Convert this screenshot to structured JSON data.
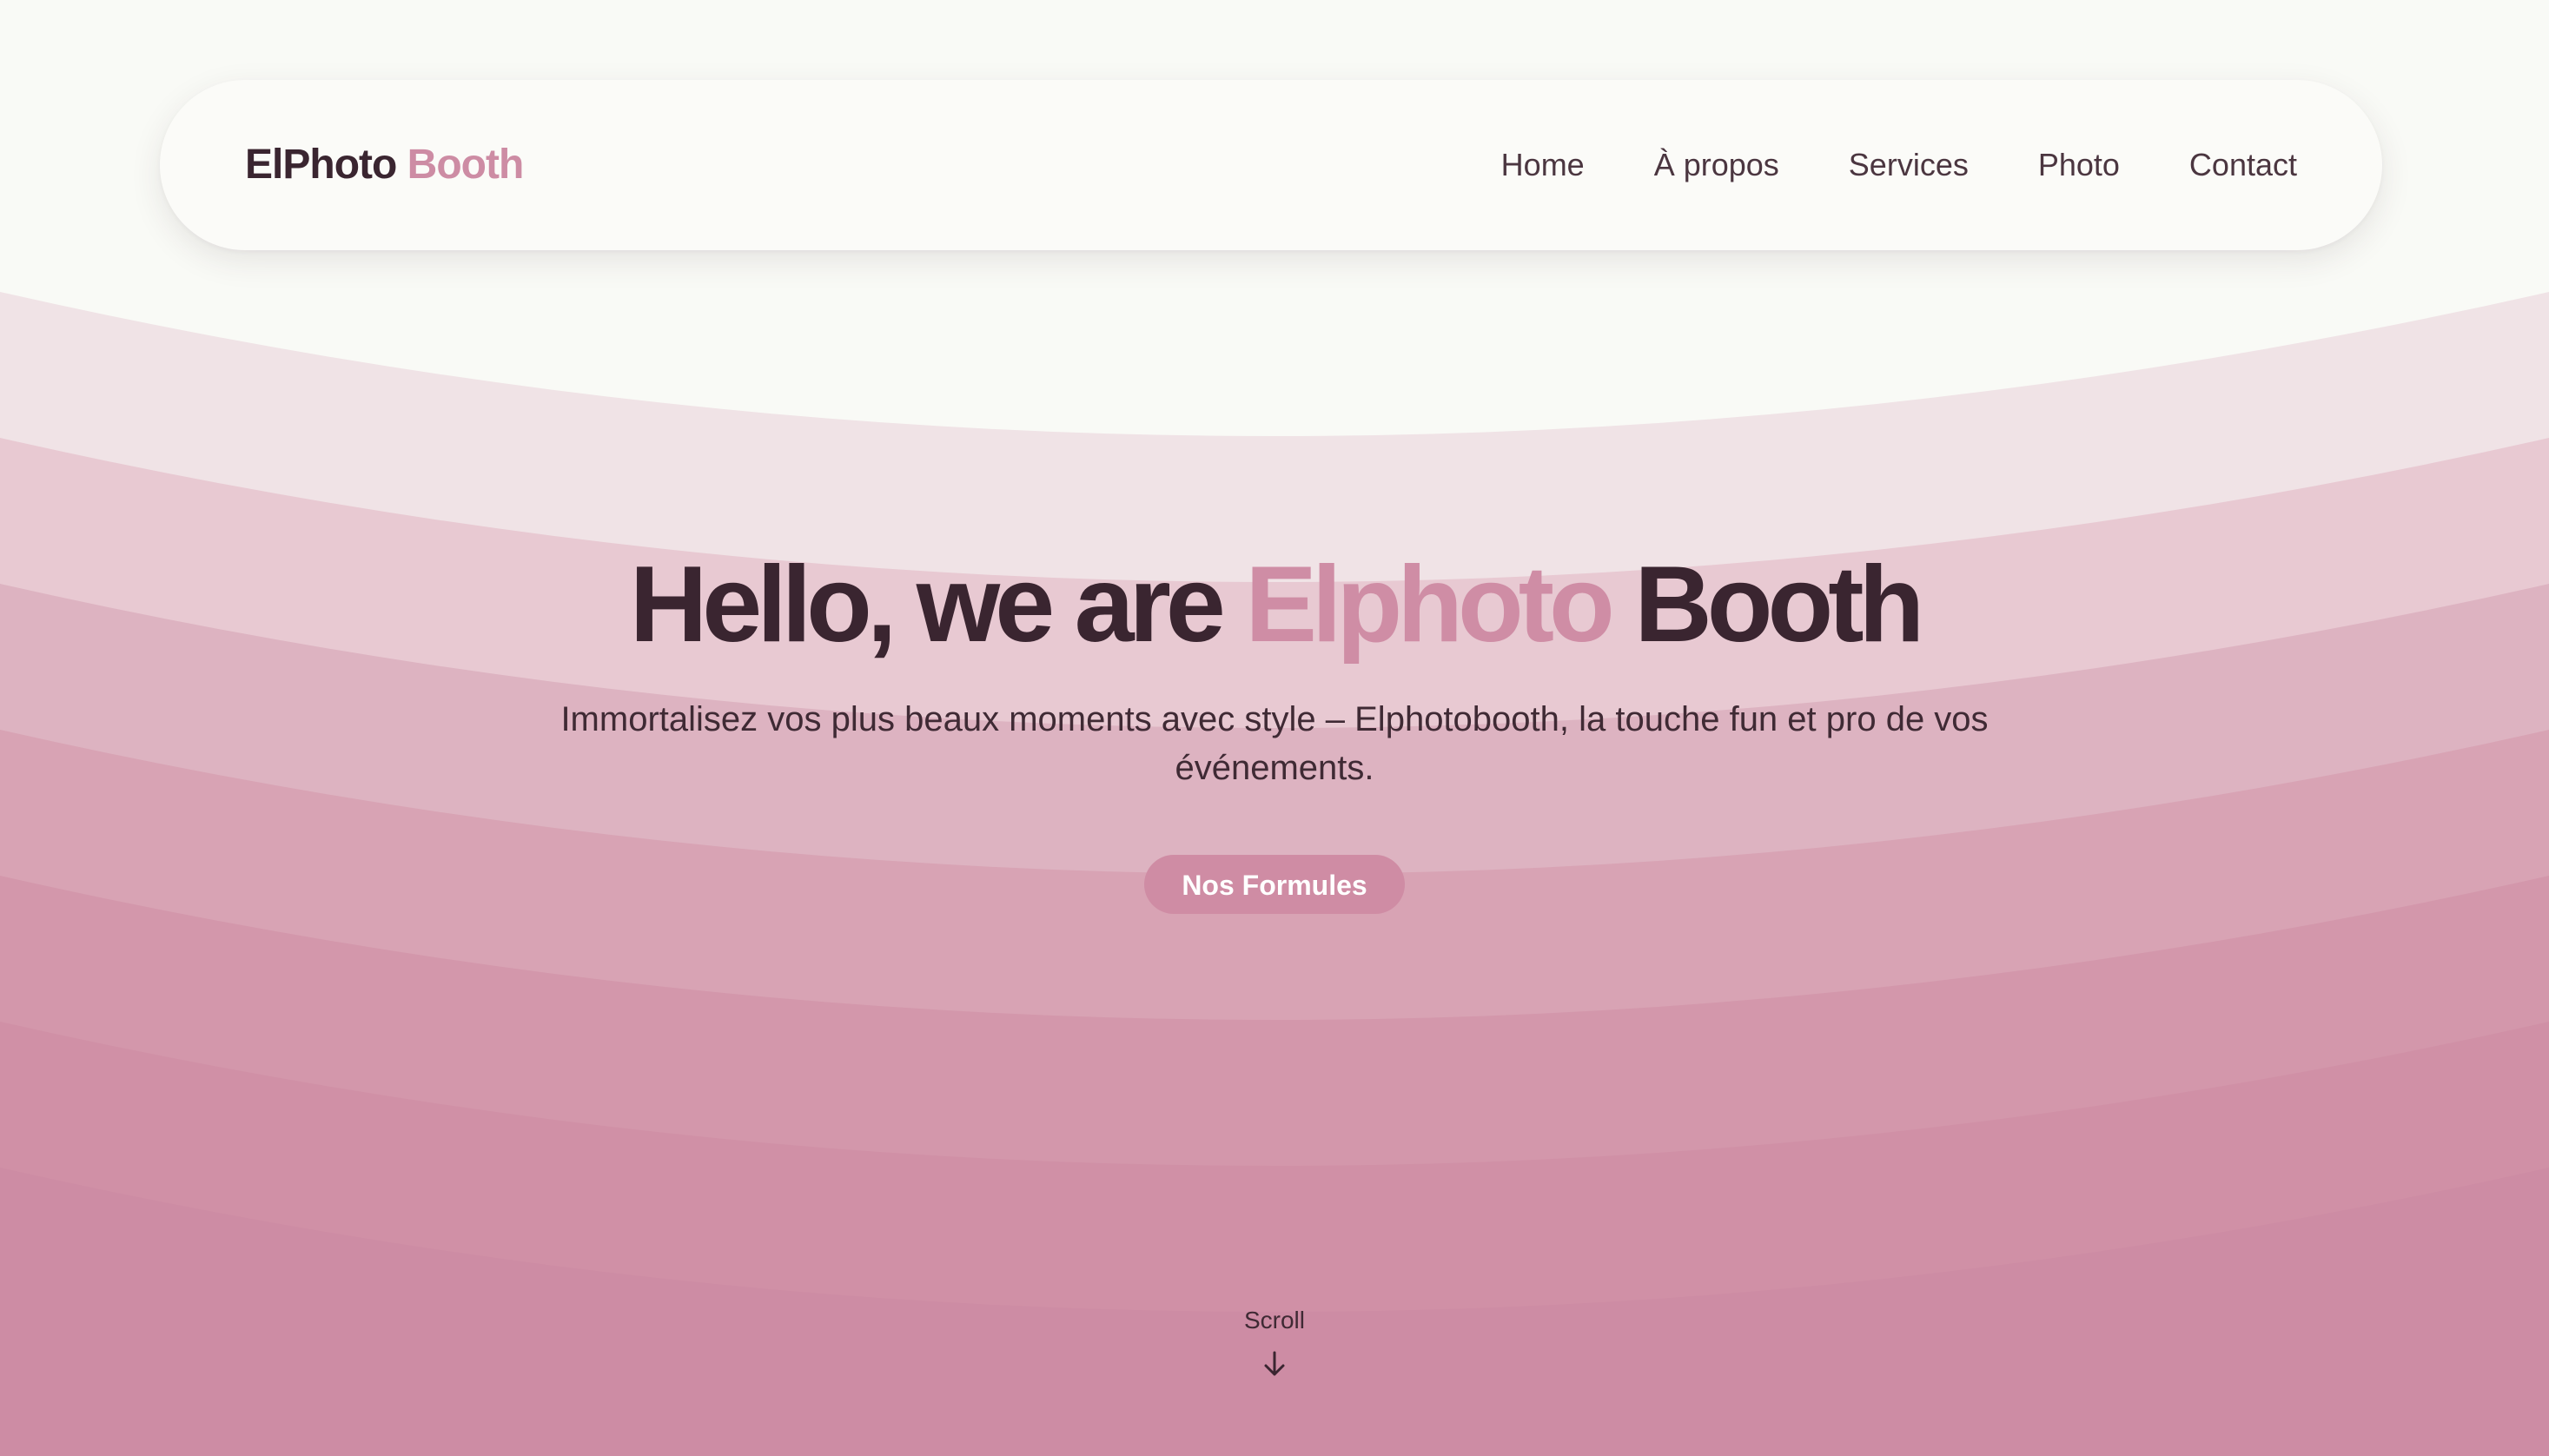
{
  "brand": {
    "name_part1": "ElPhoto",
    "name_part2": "Booth"
  },
  "nav": {
    "items": [
      "Home",
      "À propos",
      "Services",
      "Photo",
      "Contact"
    ]
  },
  "hero": {
    "title_part1": "Hello, we are",
    "title_highlight": "Elphoto",
    "title_part2": "Booth",
    "subtitle_line1": "Immortalisez vos plus beaux moments avec style – Elphotobooth, la touche fun et pro de vos",
    "subtitle_line2": "événements.",
    "cta_label": "Nos Formules"
  },
  "scroll": {
    "label": "Scroll",
    "icon": "arrow-down-icon"
  },
  "colors": {
    "background": "#f9faf6",
    "text_dark": "#3a2530",
    "accent_pink": "#cf8da5",
    "wave_bands": [
      "#f0e3e6",
      "#e8c9d2",
      "#ddb3c1",
      "#d8a3b4",
      "#d397ab",
      "#d090a6",
      "#cd8ca4"
    ]
  }
}
